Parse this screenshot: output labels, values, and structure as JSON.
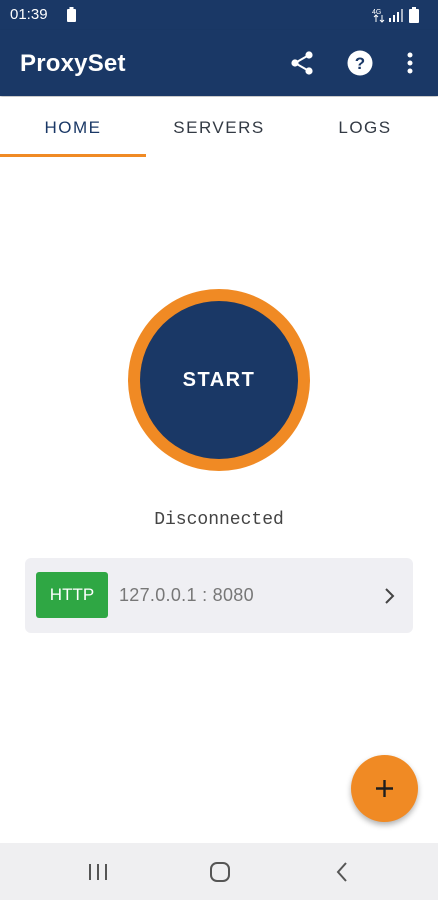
{
  "status_bar": {
    "time": "01:39",
    "network_label": "4G"
  },
  "app_bar": {
    "title": "ProxySet",
    "icons": [
      "share-icon",
      "help-icon",
      "more-vert-icon"
    ]
  },
  "tabs": [
    {
      "label": "HOME",
      "active": true
    },
    {
      "label": "SERVERS",
      "active": false
    },
    {
      "label": "LOGS",
      "active": false
    }
  ],
  "main": {
    "start_label": "START",
    "status_text": "Disconnected",
    "server": {
      "protocol": "HTTP",
      "address": "127.0.0.1 : 8080"
    }
  },
  "fab": {
    "icon": "plus-icon"
  },
  "nav_bar": {
    "icons": [
      "recent-apps-icon",
      "home-icon",
      "back-icon"
    ]
  },
  "colors": {
    "primary": "#1a3866",
    "accent": "#f08a24",
    "protocol_badge": "#2fa744",
    "card_background": "#efeff3"
  }
}
